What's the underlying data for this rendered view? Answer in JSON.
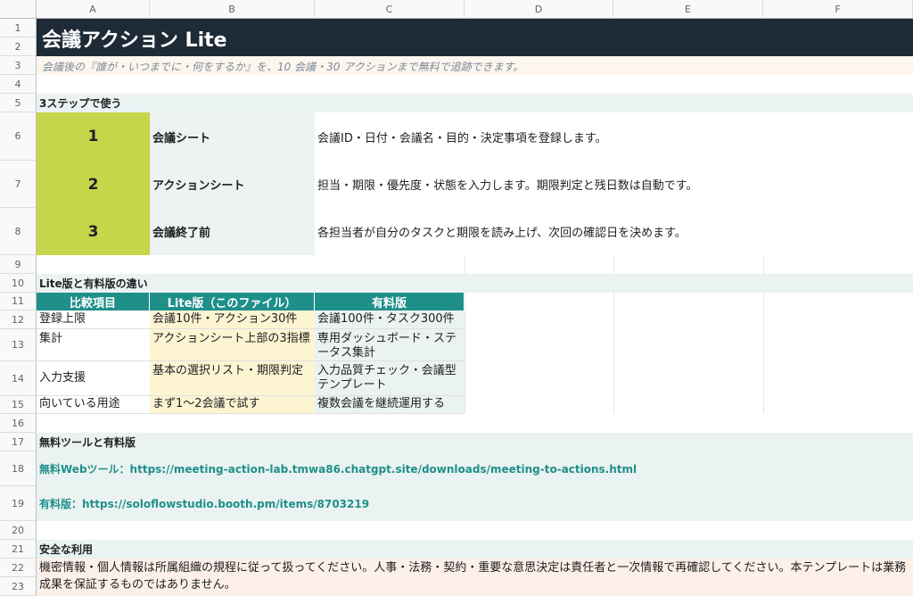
{
  "sheet": {
    "columns": [
      "A",
      "B",
      "C",
      "D",
      "E",
      "F"
    ],
    "rows": [
      "1",
      "2",
      "3",
      "4",
      "5",
      "6",
      "7",
      "8",
      "9",
      "10",
      "11",
      "12",
      "13",
      "14",
      "15",
      "16",
      "17",
      "18",
      "19",
      "20",
      "21",
      "22",
      "23"
    ]
  },
  "title": "会議アクション Lite",
  "subtitle": "会議後の『誰が・いつまでに・何をするか』を、10 会議・30 アクションまで無料で追跡できます。",
  "steps": {
    "heading": "3ステップで使う",
    "items": [
      {
        "num": "1",
        "name": "会議シート",
        "desc": "会議ID・日付・会議名・目的・決定事項を登録します。"
      },
      {
        "num": "2",
        "name": "アクションシート",
        "desc": "担当・期限・優先度・状態を入力します。期限判定と残日数は自動です。"
      },
      {
        "num": "3",
        "name": "会議終了前",
        "desc": "各担当者が自分のタスクと期限を読み上げ、次回の確認日を決めます。"
      }
    ]
  },
  "compare": {
    "heading": "Lite版と有料版の違い",
    "headers": [
      "比較項目",
      "Lite版（このファイル）",
      "有料版"
    ],
    "rows": [
      [
        "登録上限",
        "会議10件・アクション30件",
        "会議100件・タスク300件"
      ],
      [
        "集計",
        "アクションシート上部の3指標",
        "専用ダッシュボード・ステータス集計"
      ],
      [
        "入力支援",
        "基本の選択リスト・期限判定",
        "入力品質チェック・会議型テンプレート"
      ],
      [
        "向いている用途",
        "まず1〜2会議で試す",
        "複数会議を継続運用する"
      ]
    ]
  },
  "links": {
    "heading": "無料ツールと有料版",
    "free_label": "無料Webツール：",
    "free_url": "https://meeting-action-lab.tmwa86.chatgpt.site/downloads/meeting-to-actions.html",
    "paid_label": "有料版：",
    "paid_url": "https://soloflowstudio.booth.pm/items/8703219"
  },
  "safety": {
    "heading": "安全な利用",
    "text": "機密情報・個人情報は所属組織の規程に従って扱ってください。人事・法務・契約・重要な意思決定は責任者と一次情報で再確認してください。本テンプレートは業務成果を保証するものではありません。"
  }
}
